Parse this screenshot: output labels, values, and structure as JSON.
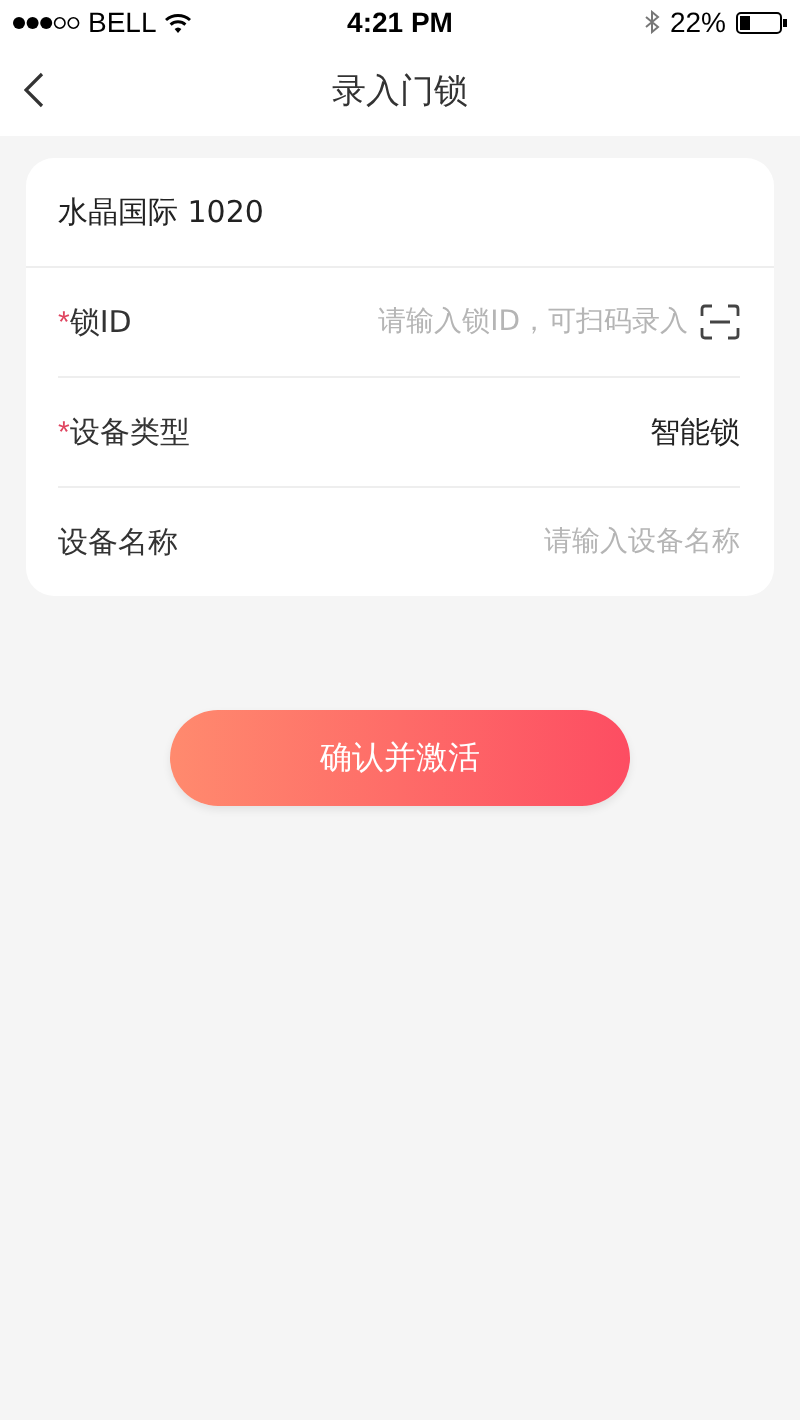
{
  "status_bar": {
    "carrier": "BELL",
    "time": "4:21 PM",
    "battery": "22%"
  },
  "nav": {
    "title": "录入门锁"
  },
  "card": {
    "header": "水晶国际 1020",
    "fields": [
      {
        "kind": "input",
        "mark": "*",
        "label": "锁ID",
        "placeholder": "请输入锁ID，可扫码录入",
        "scan": true
      },
      {
        "kind": "value",
        "mark": "*",
        "label": "设备类型",
        "value": "智能锁"
      },
      {
        "kind": "input",
        "label": "设备名称",
        "placeholder": "请输入设备名称",
        "scan": false
      }
    ]
  },
  "button": "确认并激活"
}
